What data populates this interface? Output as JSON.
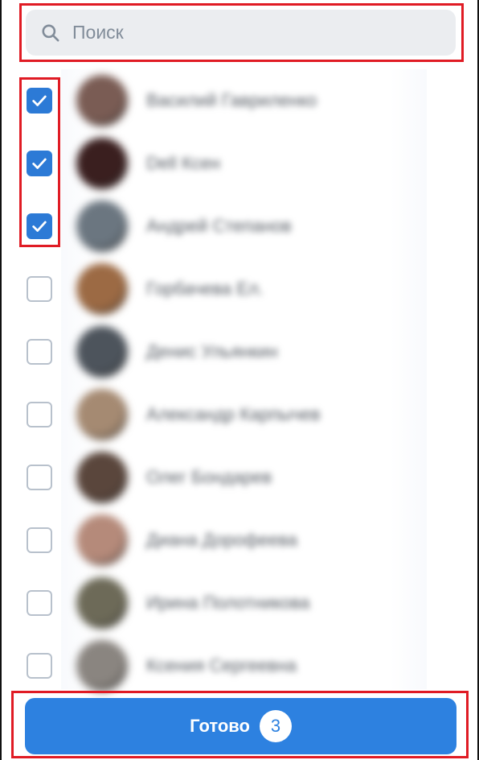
{
  "search": {
    "placeholder": "Поиск",
    "value": "",
    "icon": "search-icon"
  },
  "contacts": [
    {
      "name": "Василий Гавриленко",
      "checked": true,
      "avatar_color": "#7a5c54"
    },
    {
      "name": "Dell Ксен",
      "checked": true,
      "avatar_color": "#3a1f1f"
    },
    {
      "name": "Андрей Степанов",
      "checked": true,
      "avatar_color": "#6b7680"
    },
    {
      "name": "Горбачева Ел.",
      "checked": false,
      "avatar_color": "#9c6a44"
    },
    {
      "name": "Денис Ульянкин",
      "checked": false,
      "avatar_color": "#4d545c"
    },
    {
      "name": "Александр Карпычев",
      "checked": false,
      "avatar_color": "#a58a72"
    },
    {
      "name": "Олег Бондарев",
      "checked": false,
      "avatar_color": "#5a463c"
    },
    {
      "name": "Диана Дорофеева",
      "checked": false,
      "avatar_color": "#b58a7a"
    },
    {
      "name": "Ирина Полотникова",
      "checked": false,
      "avatar_color": "#6d6a58"
    },
    {
      "name": "Ксения Сергеевна",
      "checked": false,
      "avatar_color": "#8a8580"
    }
  ],
  "done_button": {
    "label": "Готово",
    "count": "3"
  },
  "colors": {
    "accent": "#2d81e0",
    "checkbox_checked": "#2c7ad6",
    "highlight": "#e01b24",
    "search_bg": "#ebedf0"
  }
}
